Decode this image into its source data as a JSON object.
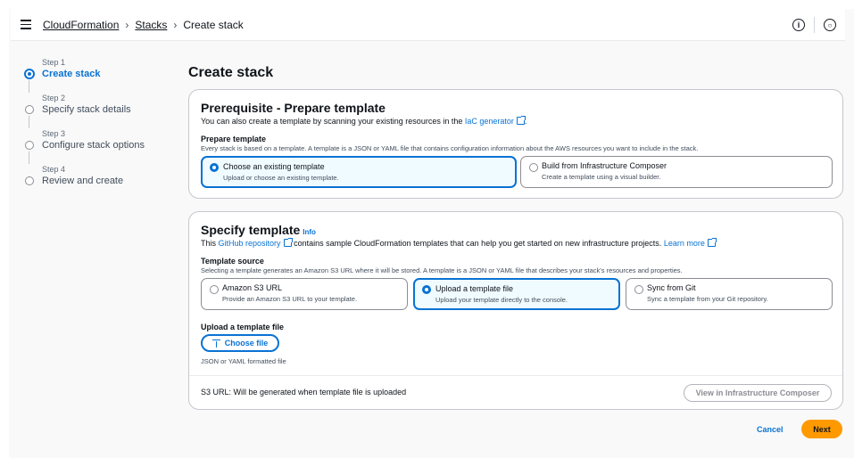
{
  "breadcrumb": {
    "items": [
      "CloudFormation",
      "Stacks"
    ],
    "current": "Create stack"
  },
  "header_icons": [
    "info-icon",
    "notification-icon"
  ],
  "wizard": {
    "steps": [
      {
        "num": "Step 1",
        "label": "Create stack",
        "active": true
      },
      {
        "num": "Step 2",
        "label": "Specify stack details",
        "active": false
      },
      {
        "num": "Step 3",
        "label": "Configure stack options",
        "active": false
      },
      {
        "num": "Step 4",
        "label": "Review and create",
        "active": false
      }
    ]
  },
  "page_title": "Create stack",
  "prerequisite": {
    "title": "Prerequisite - Prepare template",
    "subtitle_pre": "You can also create a template by scanning your existing resources in the",
    "subtitle_link": "IaC generator",
    "subtitle_post": ".",
    "label": "Prepare template",
    "desc": "Every stack is based on a template. A template is a JSON or YAML file that contains configuration information about the AWS resources you want to include in the stack.",
    "options": [
      {
        "title": "Choose an existing template",
        "desc": "Upload or choose an existing template.",
        "selected": true
      },
      {
        "title": "Build from Infrastructure Composer",
        "desc": "Create a template using a visual builder.",
        "selected": false
      }
    ]
  },
  "specify": {
    "title": "Specify template",
    "info": "Info",
    "subtitle_pre": "This",
    "subtitle_link": "GitHub repository",
    "subtitle_mid": "contains sample CloudFormation templates that can help you get started on new infrastructure projects.",
    "learn_more": "Learn more",
    "source_label": "Template source",
    "source_desc": "Selecting a template generates an Amazon S3 URL where it will be stored. A template is a JSON or YAML file that describes your stack's resources and properties.",
    "options": [
      {
        "title": "Amazon S3 URL",
        "desc": "Provide an Amazon S3 URL to your template.",
        "selected": false
      },
      {
        "title": "Upload a template file",
        "desc": "Upload your template directly to the console.",
        "selected": true
      },
      {
        "title": "Sync from Git",
        "desc": "Sync a template from your Git repository.",
        "selected": false
      }
    ],
    "upload_label": "Upload a template file",
    "choose_file": "Choose file",
    "upload_hint": "JSON or YAML formatted file",
    "s3_url": "S3 URL:   Will be generated when template file is uploaded",
    "view_composer": "View in Infrastructure Composer"
  },
  "actions": {
    "cancel": "Cancel",
    "next": "Next"
  },
  "colors": {
    "accent": "#0972d3",
    "primary_button": "#ff9900"
  }
}
